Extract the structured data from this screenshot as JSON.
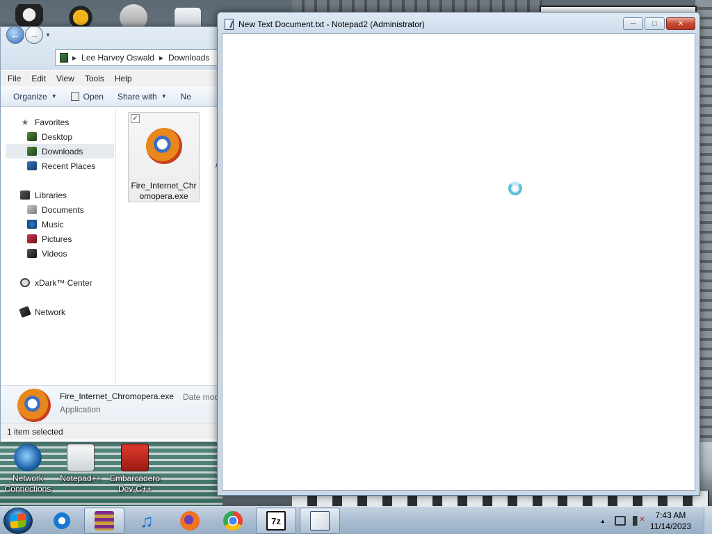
{
  "desktop": {
    "icons": [
      {
        "label_line1": "Network",
        "label_line2": "Connections"
      },
      {
        "label_line1": "Notepad++",
        "label_line2": ""
      },
      {
        "label_line1": "Embarcadero",
        "label_line2": "Dev-C++"
      }
    ]
  },
  "explorer": {
    "breadcrumb": [
      "Lee Harvey Oswald",
      "Downloads"
    ],
    "menu": [
      "File",
      "Edit",
      "View",
      "Tools",
      "Help"
    ],
    "toolbar": {
      "organize": "Organize",
      "open": "Open",
      "share_with": "Share with",
      "new_folder_partial": "Ne"
    },
    "nav": {
      "favorites": "Favorites",
      "favorites_items": [
        "Desktop",
        "Downloads",
        "Recent Places"
      ],
      "libraries": "Libraries",
      "libraries_items": [
        "Documents",
        "Music",
        "Pictures",
        "Videos"
      ],
      "xdark": "xDark™ Center",
      "network": "Network"
    },
    "file": {
      "name_line1": "Fire_Internet_Chr",
      "name_line2": "omopera.exe"
    },
    "details": {
      "name": "Fire_Internet_Chromopera.exe",
      "meta": "Date mod",
      "type": "Application"
    },
    "status": "1 item selected"
  },
  "notepad": {
    "title": "New Text Document.txt - Notepad2 (Administrator)"
  },
  "taskbar": {
    "time": "7:43 AM",
    "date": "11/14/2023",
    "apps": [
      "internet-explorer",
      "winrar",
      "itunes",
      "firefox",
      "chrome",
      "7-zip",
      "notepad2"
    ]
  },
  "colors": {
    "notepad_frame": "#c9d8e7",
    "taskbar": "#a9bdd1",
    "accent": "#2e6db2"
  }
}
